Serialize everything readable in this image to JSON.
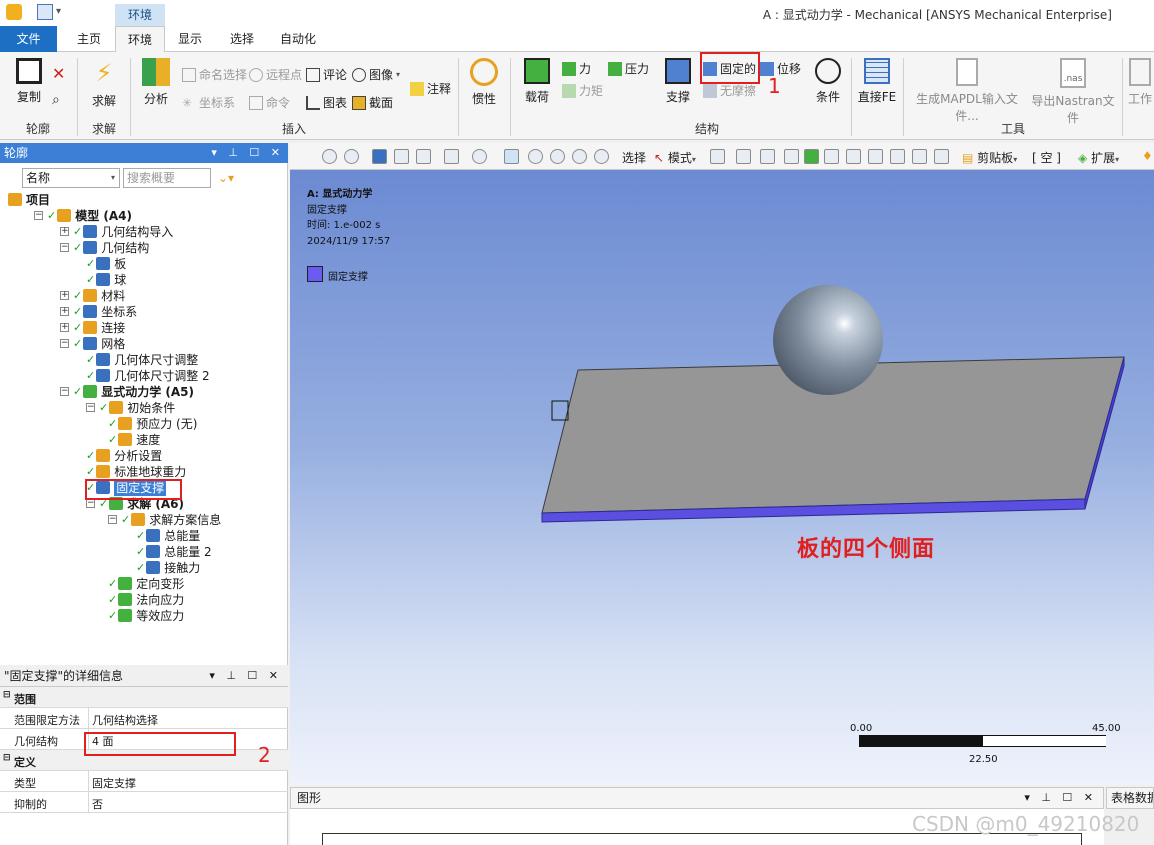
{
  "window": {
    "title": "A : 显式动力学 - Mechanical [ANSYS Mechanical Enterprise]",
    "context_tab": "环境"
  },
  "ribbon_tabs": {
    "file": "文件",
    "home": "主页",
    "environment": "环境",
    "display": "显示",
    "selection": "选择",
    "automation": "自动化"
  },
  "ribbon": {
    "outline_group": {
      "copy": "复制",
      "label": "轮廓"
    },
    "solve_group": {
      "solve": "求解",
      "label": "求解"
    },
    "insert_group": {
      "analysis": "分析",
      "named_selection": "命名选择",
      "remote_point": "远程点",
      "comment": "评论",
      "image": "图像",
      "coordinate_system": "坐标系",
      "command": "命令",
      "chart": "图表",
      "section": "截面",
      "annotation": "注释",
      "label": "插入"
    },
    "inertia": "惯性",
    "structure_group": {
      "loads": "载荷",
      "force": "力",
      "moment": "力矩",
      "pressure": "压力",
      "supports": "支撑",
      "fixed": "固定的",
      "displacement": "位移",
      "frictionless": "无摩擦",
      "label": "结构"
    },
    "conditions": "条件",
    "direct_fe": "直接FE",
    "tools_group": {
      "gen_mapdl": "生成MAPDL输入文件...",
      "export_nastran": "导出Nastran文件",
      "nas": ".nas",
      "work": "工作",
      "label": "工具"
    }
  },
  "annotations": {
    "n1": "1",
    "n2": "2",
    "side_faces": "板的四个侧面"
  },
  "outline": {
    "title": "轮廓",
    "filter_name": "名称",
    "search_placeholder": "搜索概要",
    "tree": [
      {
        "label": "项目",
        "level": 0
      },
      {
        "label": "模型 (A4)",
        "level": 1
      },
      {
        "label": "几何结构导入",
        "level": 2
      },
      {
        "label": "几何结构",
        "level": 2
      },
      {
        "label": "板",
        "level": 3
      },
      {
        "label": "球",
        "level": 3
      },
      {
        "label": "材料",
        "level": 2
      },
      {
        "label": "坐标系",
        "level": 2
      },
      {
        "label": "连接",
        "level": 2
      },
      {
        "label": "网格",
        "level": 2
      },
      {
        "label": "几何体尺寸调整",
        "level": 3
      },
      {
        "label": "几何体尺寸调整 2",
        "level": 3
      },
      {
        "label": "显式动力学 (A5)",
        "level": 2
      },
      {
        "label": "初始条件",
        "level": 3
      },
      {
        "label": "预应力 (无)",
        "level": 4
      },
      {
        "label": "速度",
        "level": 4
      },
      {
        "label": "分析设置",
        "level": 3
      },
      {
        "label": "标准地球重力",
        "level": 3
      },
      {
        "label": "固定支撑",
        "level": 3
      },
      {
        "label": "求解 (A6)",
        "level": 3
      },
      {
        "label": "求解方案信息",
        "level": 4
      },
      {
        "label": "总能量",
        "level": 5
      },
      {
        "label": "总能量 2",
        "level": 5
      },
      {
        "label": "接触力",
        "level": 5
      },
      {
        "label": "定向变形",
        "level": 4
      },
      {
        "label": "法向应力",
        "level": 4
      },
      {
        "label": "等效应力",
        "level": 4
      }
    ]
  },
  "details": {
    "title": "\"固定支撑\"的详细信息",
    "scope_section": "范围",
    "scoping_method_key": "范围限定方法",
    "scoping_method_val": "几何结构选择",
    "geometry_key": "几何结构",
    "geometry_val": "4 面",
    "definition_section": "定义",
    "type_key": "类型",
    "type_val": "固定支撑",
    "suppressed_key": "抑制的",
    "suppressed_val": "否"
  },
  "viewport_toolbar": {
    "select": "选择",
    "mode": "模式",
    "clipboard": "剪贴板",
    "empty": "[ 空 ]",
    "extend": "扩展"
  },
  "viewport": {
    "analysis": "A: 显式动力学",
    "object": "固定支撑",
    "time": "时间: 1.e-002 s",
    "date": "2024/11/9 17:57",
    "legend_label": "固定支撑",
    "legend_color": "#6a5cf0",
    "scale_min": "0.00",
    "scale_mid": "22.50",
    "scale_max": "45.00"
  },
  "bottom": {
    "graph_title": "图形",
    "table_title": "表格数据"
  },
  "watermark": "CSDN @m0_49210820"
}
